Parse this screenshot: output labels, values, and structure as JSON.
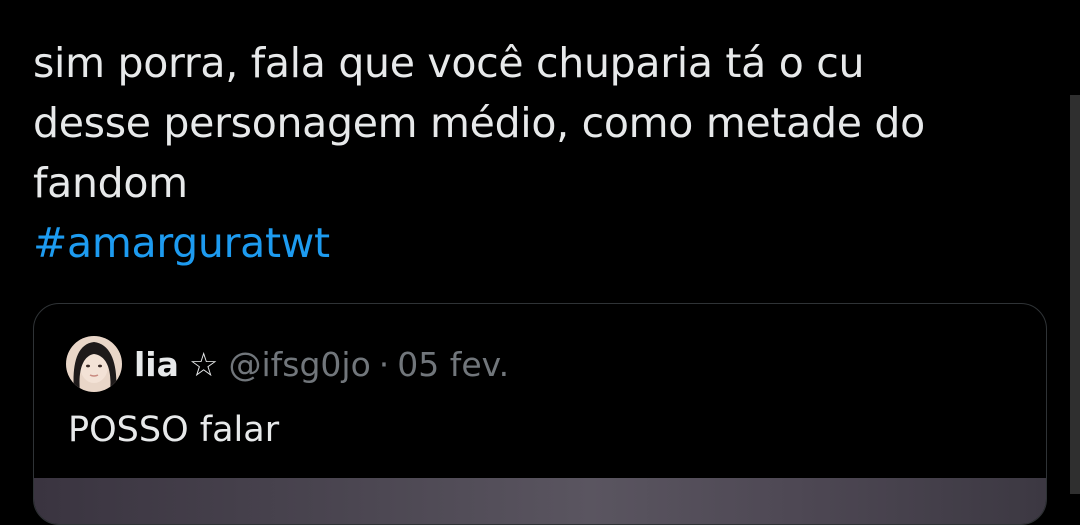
{
  "tweet": {
    "text_lines": [
      "sim porra, fala que você chuparia tá o cu",
      "desse personagem médio, como metade do",
      "fandom"
    ],
    "hashtag": "#amarguratwt",
    "hashtag_color": "#1d9bf0"
  },
  "quoted_tweet": {
    "display_name": "lia",
    "name_emoji": "☆",
    "handle": "@ifsg0jo",
    "separator": "·",
    "date": "05 fev.",
    "text": "POSSO falar",
    "avatar_icon": "profile-photo"
  },
  "theme": {
    "background": "#000000",
    "text": "#e7e9ea",
    "secondary_text": "#71767b",
    "border": "#2f3336"
  }
}
